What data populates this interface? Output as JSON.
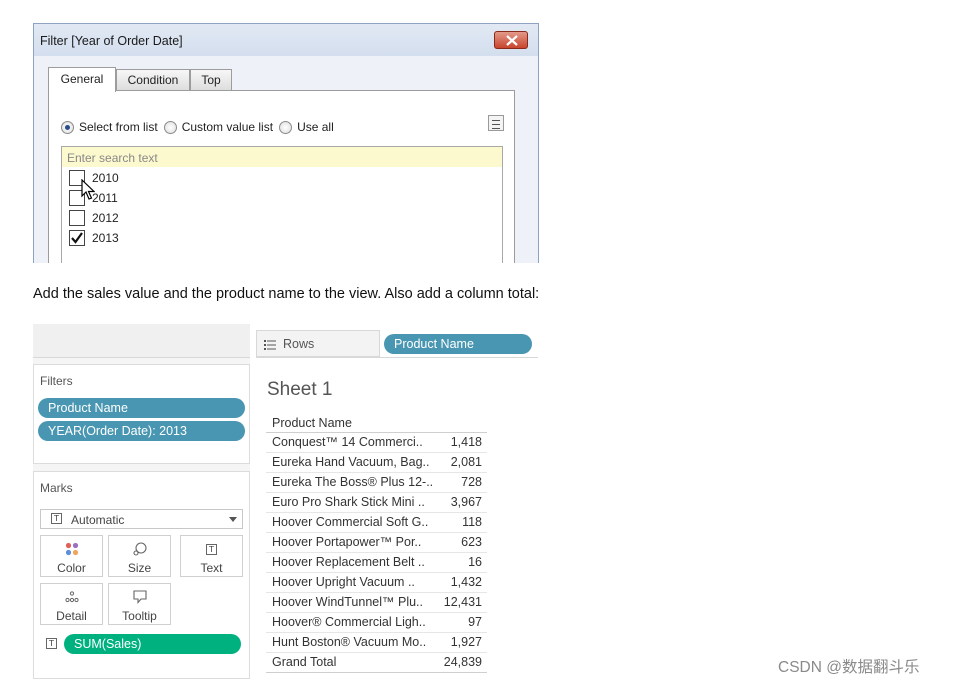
{
  "filter_dialog": {
    "title": "Filter [Year of Order Date]",
    "tabs": [
      {
        "label": "General",
        "active": true
      },
      {
        "label": "Condition",
        "active": false
      },
      {
        "label": "Top",
        "active": false
      }
    ],
    "options": [
      {
        "label": "Select from list",
        "selected": true
      },
      {
        "label": "Custom value list",
        "selected": false
      },
      {
        "label": "Use all",
        "selected": false
      }
    ],
    "search_placeholder": "Enter search text",
    "years": [
      {
        "label": "2010",
        "checked": false
      },
      {
        "label": "2011",
        "checked": false
      },
      {
        "label": "2012",
        "checked": false
      },
      {
        "label": "2013",
        "checked": true
      }
    ]
  },
  "instruction": "Add the sales value and the product name to the view. Also add a column total:",
  "workspace": {
    "rows_label": "Rows",
    "rows_pill": "Product Name",
    "filters_title": "Filters",
    "filter_pills": [
      "Product Name",
      "YEAR(Order Date): 2013"
    ],
    "marks_title": "Marks",
    "mark_type": "Automatic",
    "mark_buttons": {
      "color": "Color",
      "size": "Size",
      "text": "Text",
      "detail": "Detail",
      "tooltip": "Tooltip"
    },
    "marks_pill": "SUM(Sales)",
    "sheet_title": "Sheet 1",
    "table": {
      "header": "Product Name",
      "rows": [
        {
          "name": "Conquest™ 14 Commerci..",
          "value": "1,418"
        },
        {
          "name": "Eureka Hand Vacuum, Bag..",
          "value": "2,081"
        },
        {
          "name": "Eureka The Boss® Plus 12-..",
          "value": "728"
        },
        {
          "name": "Euro Pro Shark Stick Mini ..",
          "value": "3,967"
        },
        {
          "name": "Hoover Commercial Soft G..",
          "value": "118"
        },
        {
          "name": "Hoover Portapower™ Por..",
          "value": "623"
        },
        {
          "name": "Hoover Replacement Belt ..",
          "value": "16"
        },
        {
          "name": "Hoover Upright Vacuum ..",
          "value": "1,432"
        },
        {
          "name": "Hoover WindTunnel™ Plu..",
          "value": "12,431"
        },
        {
          "name": "Hoover® Commercial Ligh..",
          "value": "97"
        },
        {
          "name": "Hunt Boston® Vacuum Mo..",
          "value": "1,927"
        }
      ],
      "total_label": "Grand Total",
      "total_value": "24,839"
    }
  },
  "watermark": "CSDN @数据翻斗乐",
  "colors": {
    "pill_blue": "#4996b2",
    "pill_green": "#00b180",
    "search_bg": "#fdf9cf",
    "close_button": "#c8452d"
  }
}
